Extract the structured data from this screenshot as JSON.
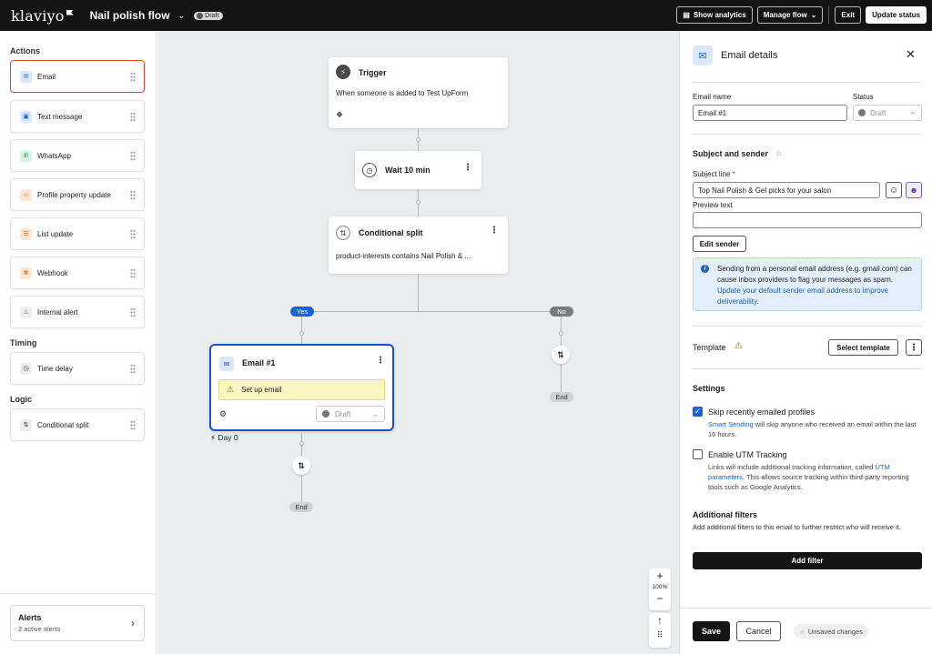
{
  "topbar": {
    "logo": "klaviyo",
    "flow_title": "Nail polish flow",
    "status_pill": "Draft",
    "show_analytics": "Show analytics",
    "manage_flow": "Manage flow",
    "exit": "Exit",
    "update_status": "Update status"
  },
  "sidebar": {
    "actions_label": "Actions",
    "actions": [
      {
        "label": "Email",
        "icon": "email-icon"
      },
      {
        "label": "Text message",
        "icon": "sms-icon"
      },
      {
        "label": "WhatsApp",
        "icon": "whatsapp-icon"
      },
      {
        "label": "Profile property update",
        "icon": "profile-icon"
      },
      {
        "label": "List update",
        "icon": "list-icon"
      },
      {
        "label": "Webhook",
        "icon": "webhook-icon"
      },
      {
        "label": "Internal alert",
        "icon": "bell-icon"
      }
    ],
    "timing_label": "Timing",
    "timing": [
      {
        "label": "Time delay",
        "icon": "clock-icon"
      }
    ],
    "logic_label": "Logic",
    "logic": [
      {
        "label": "Conditional split",
        "icon": "split-icon"
      }
    ],
    "alerts": {
      "title": "Alerts",
      "subtitle": "2 active alerts"
    }
  },
  "canvas": {
    "trigger": {
      "title": "Trigger",
      "body": "When someone is added to Test UpForm"
    },
    "wait": {
      "title": "Wait 10 min"
    },
    "split": {
      "title": "Conditional split",
      "body": "product-interests contains Nail Polish & ..."
    },
    "yes": "Yes",
    "no": "No",
    "end": "End",
    "email_node": {
      "title": "Email #1",
      "warning": "Set up email",
      "status": "Draft",
      "day": "Day 0"
    },
    "zoom_level": "100%"
  },
  "panel": {
    "title": "Email details",
    "email_name_label": "Email name",
    "email_name_value": "Email #1",
    "status_label": "Status",
    "status_value": "Draft",
    "subject_sender_heading": "Subject and sender",
    "subject_line_label": "Subject line",
    "required_mark": "*",
    "subject_line_value": "Top Nail Polish & Gel picks for your salon",
    "preview_text_label": "Preview text",
    "preview_text_value": "",
    "edit_sender": "Edit sender",
    "info_text": "Sending from a personal email address (e.g. gmail.com) can cause inbox providers to flag your messages as spam.",
    "info_link": "Update your default sender email address to improve deliverability.",
    "template_label": "Template",
    "select_template": "Select template",
    "settings_heading": "Settings",
    "skip_label": "Skip recently emailed profiles",
    "skip_link": "Smart Sending",
    "skip_desc": "will skip anyone who received an email within the last 16 hours.",
    "utm_label": "Enable UTM Tracking",
    "utm_desc_pre": "Links will include additional tracking information, called",
    "utm_link": "UTM parameters",
    "utm_desc_post": ". This allows source tracking within third-party reporting tools such as Google Analytics.",
    "filters_heading": "Additional filters",
    "filters_desc": "Add additional filters to this email to further restrict who will receive it.",
    "add_filter": "Add filter",
    "save": "Save",
    "cancel": "Cancel",
    "unsaved": "Unsaved changes"
  },
  "colors": {
    "accent_blue": "#1963d6",
    "selected_red": "#e5432f",
    "topbar_bg": "#141414",
    "warning_yellow": "#fbf5c2"
  }
}
